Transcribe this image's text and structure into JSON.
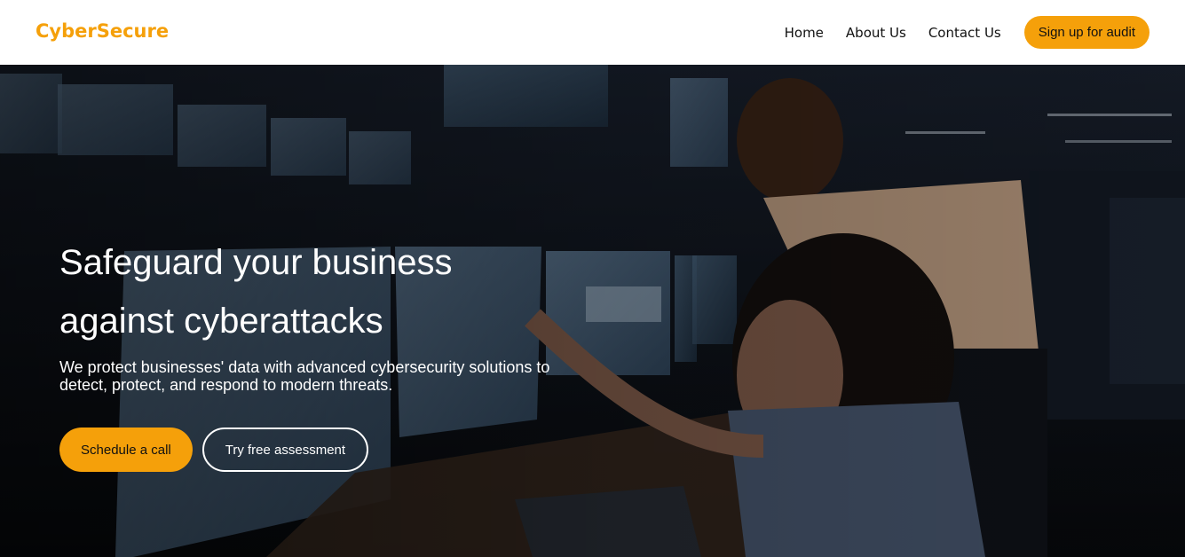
{
  "brand": {
    "name": "CyberSecure",
    "color": "#f5a00a"
  },
  "nav": {
    "items": [
      {
        "label": "Home"
      },
      {
        "label": "About Us"
      },
      {
        "label": "Contact Us"
      }
    ],
    "cta_label": "Sign up for audit"
  },
  "hero": {
    "title_line1": "Safeguard your business",
    "title_line2": "against cyberattacks",
    "subtitle": "We protect businesses' data with advanced cybersecurity solutions to detect, protect, and respond to modern threats.",
    "primary_button": "Schedule a call",
    "secondary_button": "Try free assessment",
    "background_image": "security-operations-center-photo"
  }
}
